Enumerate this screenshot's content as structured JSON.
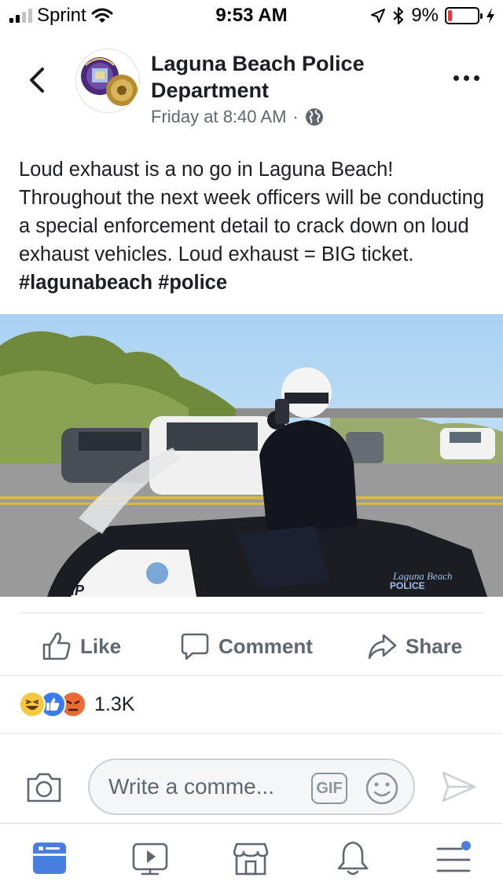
{
  "status_bar": {
    "carrier": "Sprint",
    "time": "9:53 AM",
    "battery_percent": "9%",
    "battery_level": 0.09
  },
  "post": {
    "page_name": "Laguna Beach Police Department",
    "timestamp": "Friday at 8:40 AM",
    "separator": "·",
    "text": "Loud exhaust is a no go in Laguna Beach! Throughout the next week officers will be conducting a special enforcement detail to crack down on loud exhaust vehicles. Loud exhaust = BIG ticket.",
    "hashtags": [
      "#lagunabeach",
      "#police"
    ],
    "image_alt": "Motorcycle police officer using a sound meter beside a road",
    "image_text": {
      "bike_side": "Laguna Beach",
      "bike_police": "POLICE",
      "bike_front": "MP"
    }
  },
  "actions": {
    "like": "Like",
    "comment": "Comment",
    "share": "Share"
  },
  "reactions": {
    "count": "1.3K",
    "icons": [
      "haha-icon",
      "like-icon",
      "angry-icon"
    ]
  },
  "comment_bar": {
    "placeholder": "Write a comme...",
    "gif_label": "GIF"
  },
  "tab_bar": {
    "items": [
      "news-feed-icon",
      "watch-icon",
      "marketplace-icon",
      "notifications-icon",
      "menu-icon"
    ],
    "active": "news-feed-icon"
  },
  "colors": {
    "accent": "#4a7ede",
    "text": "#1c1e21",
    "secondary_text": "#606770",
    "battery_low": "#e53935"
  }
}
